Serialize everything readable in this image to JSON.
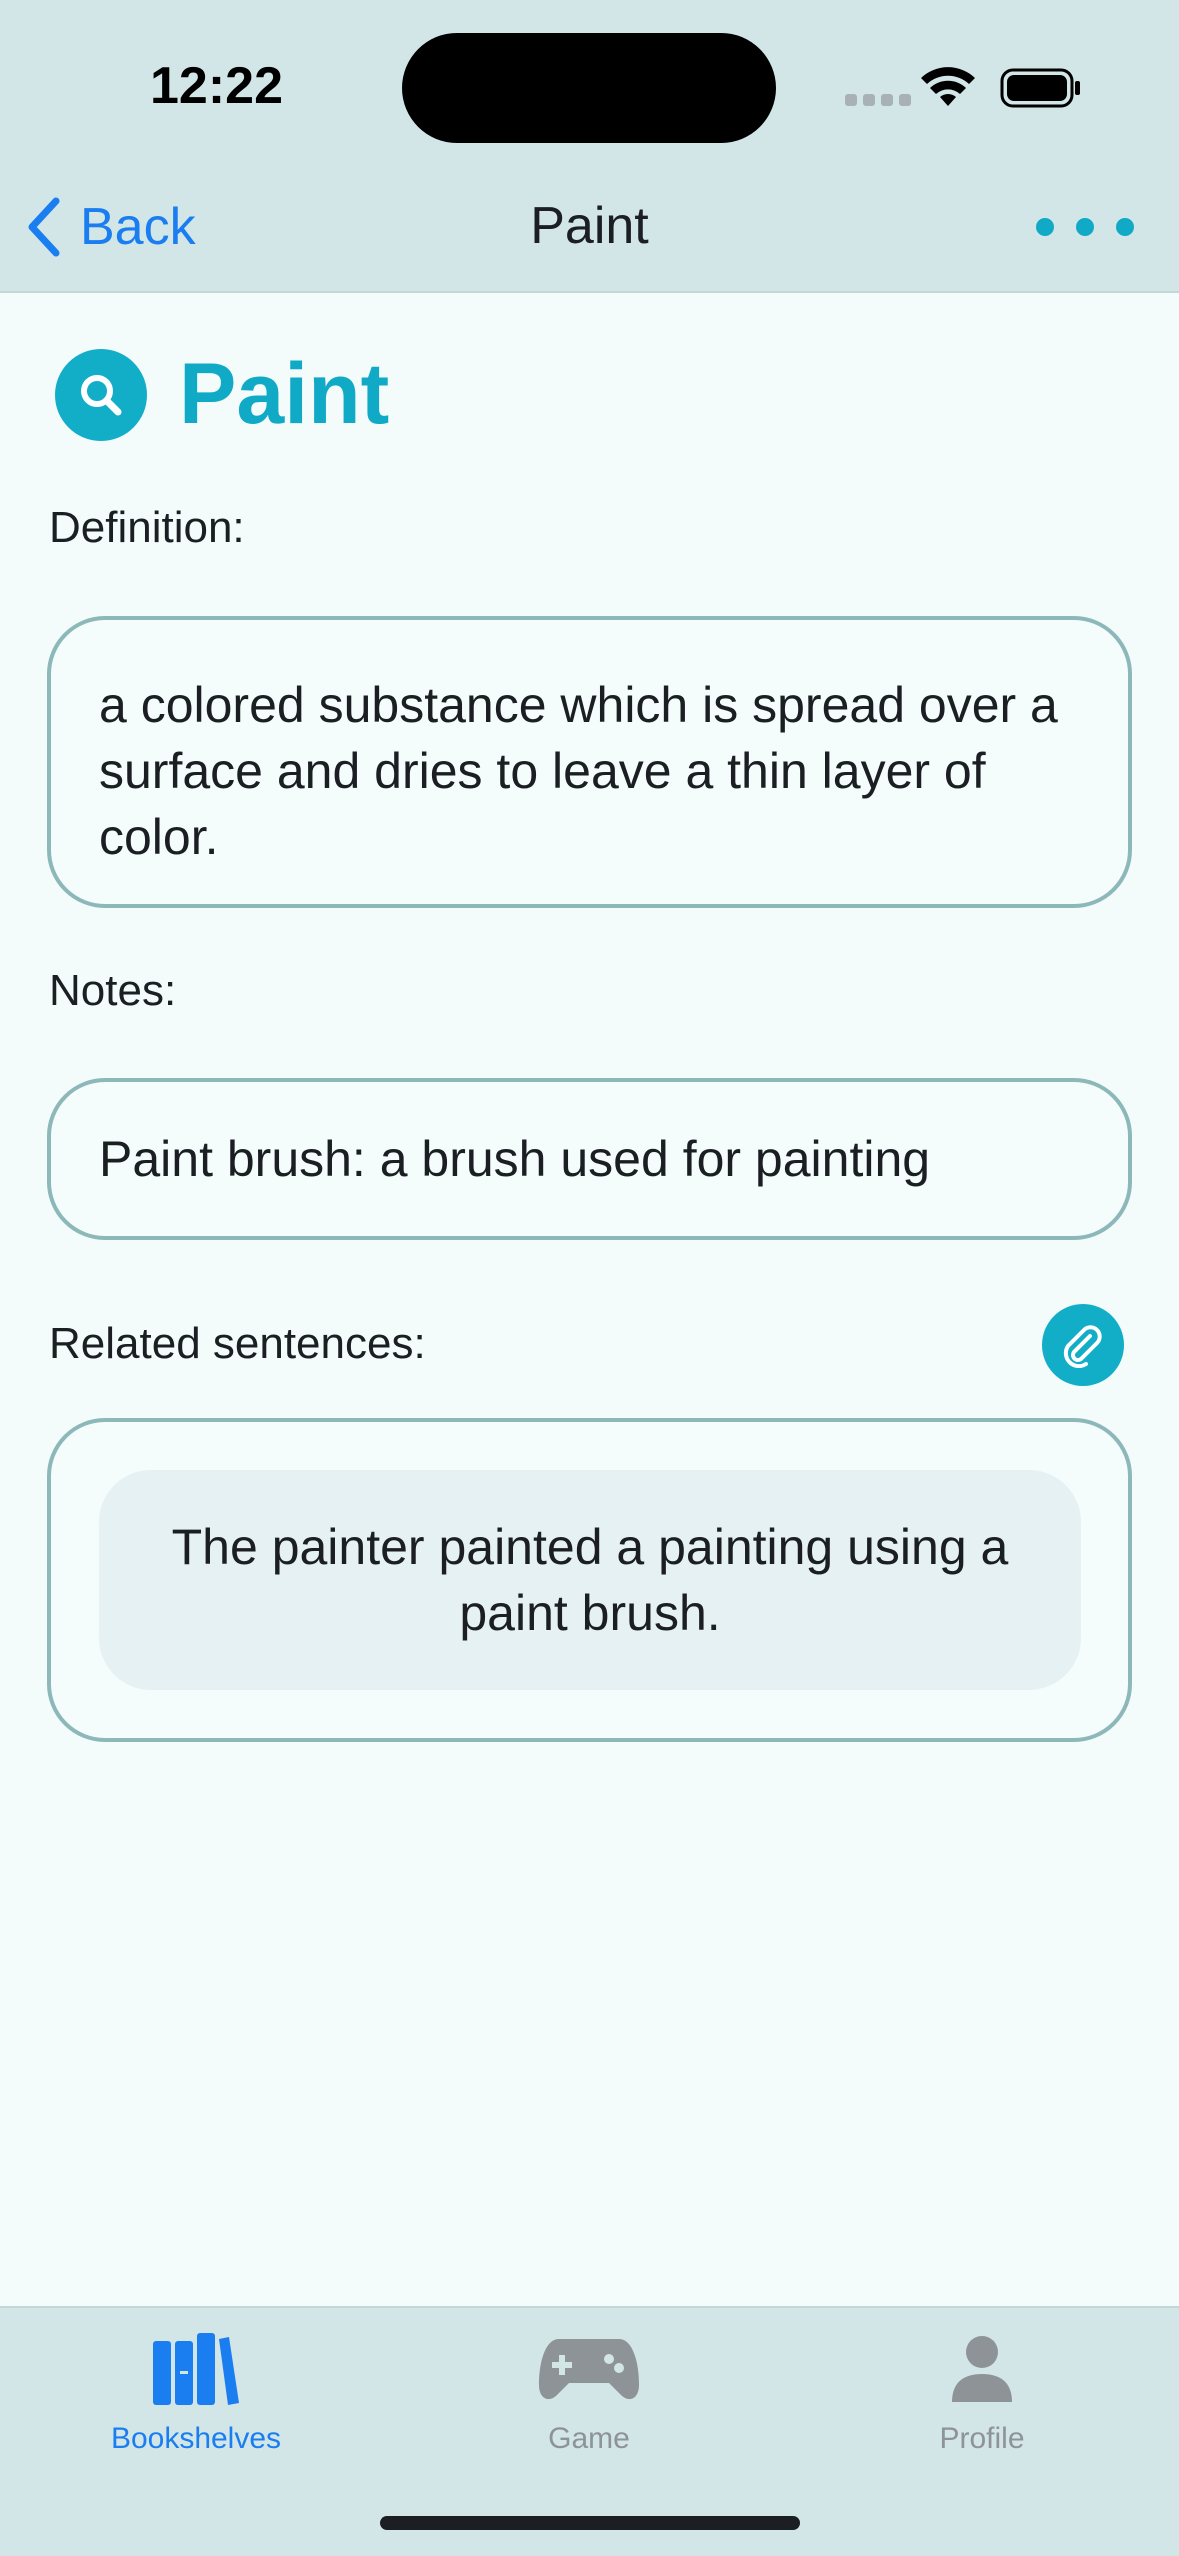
{
  "status_bar": {
    "time": "12:22"
  },
  "nav": {
    "back_label": "Back",
    "title": "Paint",
    "more_icon": "ellipsis-icon"
  },
  "word": {
    "title": "Paint",
    "icon": "search-icon",
    "accent_color": "#11aac6"
  },
  "definition": {
    "label": "Definition:",
    "text": "a colored substance which is spread over a surface and dries to leave a thin layer of color."
  },
  "notes": {
    "label": "Notes:",
    "text": "Paint brush: a brush used for painting"
  },
  "related": {
    "label": "Related sentences:",
    "attach_icon": "paperclip-icon",
    "sentences": [
      "The painter painted a painting using a paint brush."
    ]
  },
  "tabbar": {
    "tabs": [
      {
        "label": "Bookshelves",
        "icon": "bookshelves-icon",
        "active": true
      },
      {
        "label": "Game",
        "icon": "gamepad-icon",
        "active": false
      },
      {
        "label": "Profile",
        "icon": "person-icon",
        "active": false
      }
    ],
    "active_color": "#1a7df0",
    "inactive_color": "#8e9397"
  }
}
